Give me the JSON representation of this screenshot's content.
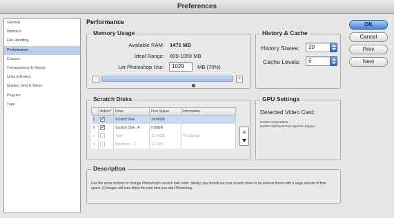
{
  "window": {
    "title": "Preferences"
  },
  "sidebar": {
    "items": [
      {
        "label": "General",
        "active": false
      },
      {
        "label": "Interface",
        "active": false
      },
      {
        "label": "File Handling",
        "active": false
      },
      {
        "label": "Performance",
        "active": true
      },
      {
        "label": "Cursors",
        "active": false
      },
      {
        "label": "Transparency & Gamut",
        "active": false
      },
      {
        "label": "Units & Rulers",
        "active": false
      },
      {
        "label": "Guides, Grid & Slices",
        "active": false
      },
      {
        "label": "Plug-ins",
        "active": false
      },
      {
        "label": "Type",
        "active": false
      }
    ]
  },
  "panel": {
    "title": "Performance"
  },
  "memory_usage": {
    "heading": "Memory Usage",
    "available_ram_label": "Available RAM:",
    "available_ram_value": "1471 MB",
    "ideal_range_label": "Ideal Range:",
    "ideal_range_value": "809-1059 MB",
    "let_use_label": "Let Photoshop Use:",
    "let_use_value": "1029",
    "let_use_unit": "MB (70%)",
    "slider_fraction": 0.7,
    "minus_label": "-",
    "plus_label": "+"
  },
  "history_cache": {
    "heading": "History & Cache",
    "history_states_label": "History States:",
    "history_states_value": "20",
    "cache_levels_label": "Cache Levels:",
    "cache_levels_value": "6"
  },
  "scratch_disks": {
    "heading": "Scratch Disks",
    "columns": [
      "Active?",
      "Drive",
      "Free Space",
      "Information"
    ],
    "rows": [
      {
        "num": "1",
        "active": true,
        "drive": "Scratch Disk",
        "free": "14.89GB",
        "info": "",
        "selected": true,
        "dim": false
      },
      {
        "num": "2",
        "active": true,
        "drive": "Scratch Disk - A",
        "free": "5.89GB",
        "info": "",
        "selected": false,
        "dim": false
      },
      {
        "num": "3",
        "active": false,
        "drive": "Tiger",
        "free": "15.54GB",
        "info": "PS Startup",
        "selected": false,
        "dim": true
      },
      {
        "num": "4",
        "active": false,
        "drive": "Backbone - 1",
        "free": "12.2GB",
        "info": "",
        "selected": false,
        "dim": true
      }
    ]
  },
  "gpu_settings": {
    "heading": "GPU Settings",
    "detected_label": "Detected Video Card:",
    "vendor": "NVIDIA Corporation",
    "card": "NVIDIA GeForce2 MX OpenGL Engine"
  },
  "description": {
    "heading": "Description",
    "text": "Use the arrow buttons to change Photoshop's scratch disk order. Ideally, you should set your scratch disks to be internal drives with a large amount of free space. (Changes will take effect the next time you start Photoshop."
  },
  "buttons": {
    "ok": "OK",
    "cancel": "Cancel",
    "prev": "Prev",
    "next": "Next"
  }
}
